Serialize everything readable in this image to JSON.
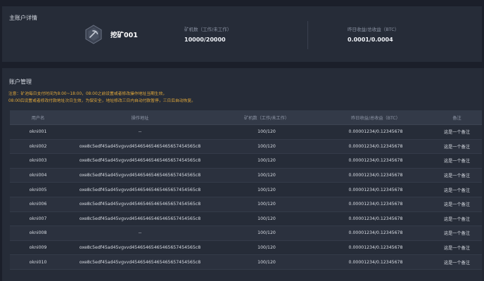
{
  "main_account": {
    "section_title": "主账户详情",
    "name": "挖矿001",
    "stats": [
      {
        "label": "矿机数（工作/未工作）",
        "value": "10000/20000"
      },
      {
        "label": "昨日收益/总收益（BTC）",
        "value": "0.0001/0.0004"
      }
    ]
  },
  "account_management": {
    "section_title": "账户管理",
    "notice_lines": [
      "注意：矿池每日支付时间为8:00~18:00，08:00之前设置或者修改操作地址当期生效，",
      "08:00后设置或者修改付款地址次日生效，为保安全，地址修改三日内自动付款暂停，三日后自动恢复。"
    ],
    "columns": [
      "用户名",
      "操作地址",
      "矿机数（工作/未工作）",
      "昨日收益/总收益（BTC）",
      "备注"
    ],
    "rows": [
      {
        "username": "okni001",
        "address": "--",
        "miners": "100/120",
        "earnings": "0.00001234/0.12345678",
        "note": "这是一个备注"
      },
      {
        "username": "okni002",
        "address": "oxe8c5edf45ad45vgvvd45465465465465657454565c8",
        "miners": "100/120",
        "earnings": "0.00001234/0.12345678",
        "note": "这是一个备注"
      },
      {
        "username": "okni003",
        "address": "oxe8c5edf45ad45vgvvd45465465465465657454565c8",
        "miners": "100/120",
        "earnings": "0.00001234/0.12345678",
        "note": "这是一个备注"
      },
      {
        "username": "okni004",
        "address": "oxe8c5edf45ad45vgvvd45465465465465657454565c8",
        "miners": "100/120",
        "earnings": "0.00001234/0.12345678",
        "note": "这是一个备注"
      },
      {
        "username": "okni005",
        "address": "oxe8c5edf45ad45vgvvd45465465465465657454565c8",
        "miners": "100/120",
        "earnings": "0.00001234/0.12345678",
        "note": "这是一个备注"
      },
      {
        "username": "okni006",
        "address": "oxe8c5edf45ad45vgvvd45465465465465657454565c8",
        "miners": "100/120",
        "earnings": "0.00001234/0.12345678",
        "note": "这是一个备注"
      },
      {
        "username": "okni007",
        "address": "oxe8c5edf45ad45vgvvd45465465465465657454565c8",
        "miners": "100/120",
        "earnings": "0.00001234/0.12345678",
        "note": "这是一个备注"
      },
      {
        "username": "okni008",
        "address": "--",
        "miners": "100/120",
        "earnings": "0.00001234/0.12345678",
        "note": "这是一个备注"
      },
      {
        "username": "okni009",
        "address": "oxe8c5edf45ad45vgvvd45465465465465657454565c8",
        "miners": "100/120",
        "earnings": "0.00001234/0.12345678",
        "note": "这是一个备注"
      },
      {
        "username": "okni010",
        "address": "oxe8c5edf45ad45vgvvd45465465465465657454565c8",
        "miners": "100/120",
        "earnings": "0.00001234/0.12345678",
        "note": "这是一个备注"
      }
    ]
  },
  "icons": {
    "account_icon": "mining-pick-icon"
  },
  "colors": {
    "notice": "#e3a93a",
    "panel": "#262c38",
    "background": "#1b1f2a"
  }
}
